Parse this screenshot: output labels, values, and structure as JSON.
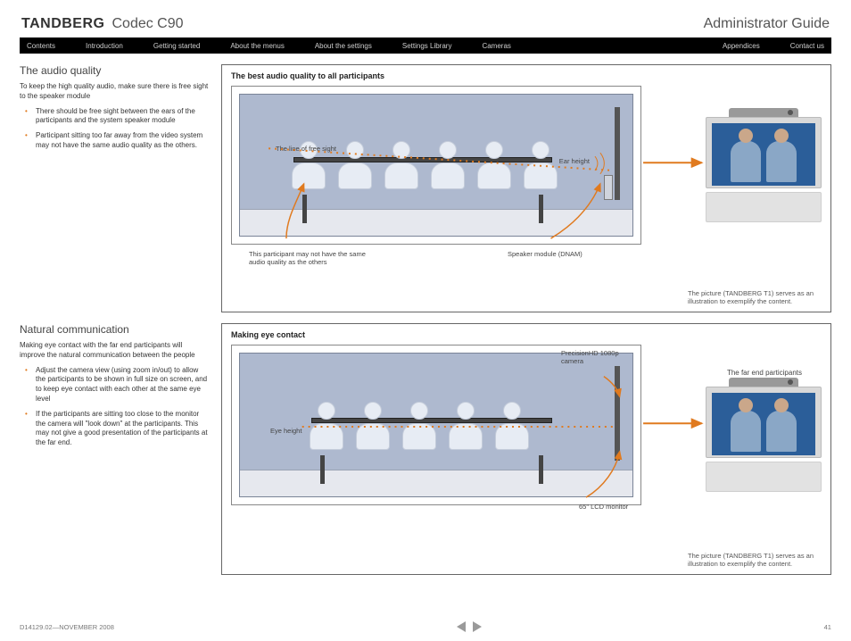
{
  "header": {
    "brand": "TANDBERG",
    "product": "Codec C90",
    "doc_title": "Administrator Guide"
  },
  "nav": {
    "left": [
      "Contents",
      "Introduction",
      "Getting started",
      "About the menus",
      "About the settings",
      "Settings Library",
      "Cameras"
    ],
    "right": [
      "Appendices",
      "Contact us"
    ]
  },
  "section1": {
    "title": "The audio quality",
    "intro": "To keep the high quality audio, make sure there is free sight to the speaker module",
    "bullets": [
      "There should be free sight between the ears of the participants and the system speaker module",
      "Participant sitting too far away from the video system may not have the same audio quality as the others."
    ],
    "panel_title": "The best audio quality to all participants",
    "labels": {
      "line_of_free_sight": "The line of free sight",
      "ear_height": "Ear height",
      "anno_participant": "This participant may not have the same audio quality as the others",
      "anno_speaker": "Speaker module (DNAM)",
      "device_caption": "The picture (TANDBERG T1) serves as an illustration to exemplify the content."
    }
  },
  "section2": {
    "title": "Natural communication",
    "intro": "Making eye contact with the far end participants will improve the natural communication between the people",
    "bullets": [
      "Adjust the camera view (using zoom in/out) to allow the participants to be shown in full size on screen, and to keep eye contact with each other at the same eye level",
      "If the participants are sitting too close to the monitor the camera will \"look down\" at the participants. This may not give a good presentation of the participants at the far end."
    ],
    "panel_title": "Making eye contact",
    "labels": {
      "eye_height": "Eye height",
      "camera": "PrecisionHD 1080p camera",
      "monitor": "65\" LCD monitor",
      "far_end": "The far end participants",
      "device_caption": "The picture (TANDBERG T1) serves as an illustration to exemplify the content."
    }
  },
  "footer": {
    "docref": "D14129.02—NOVEMBER 2008",
    "page": "41"
  }
}
